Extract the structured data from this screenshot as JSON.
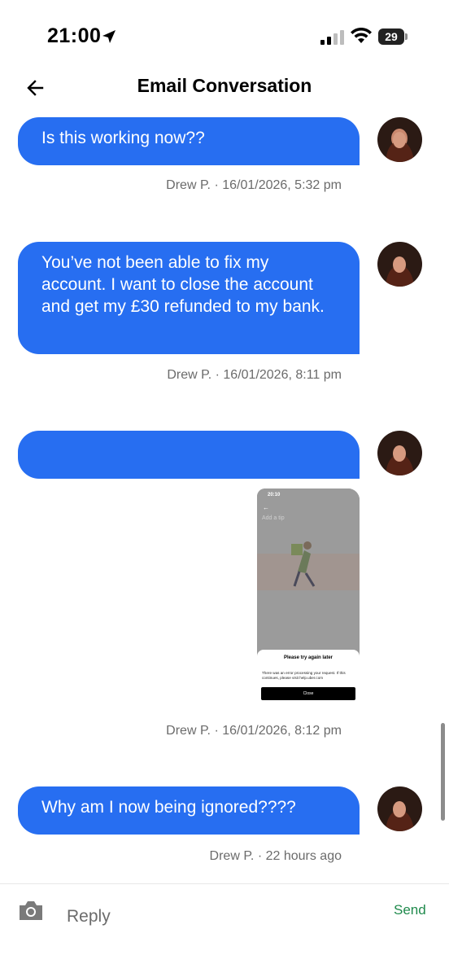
{
  "status_bar": {
    "time": "21:00",
    "battery": "29"
  },
  "header": {
    "title": "Email Conversation",
    "back_icon": "arrow-left-icon"
  },
  "messages": [
    {
      "text": "Is this working now??",
      "meta": "Drew P. · 16/01/2026, 5:32 pm"
    },
    {
      "text": "You’ve not been able to fix my account. I want to close the account and get my £30 refunded to my bank.",
      "meta": "Drew P. · 16/01/2026, 8:11 pm"
    },
    {
      "text": "",
      "meta": "Drew P. · 16/01/2026, 8:12 pm"
    },
    {
      "text": "Why am I now being ignored????",
      "meta": "Drew P. · 22 hours ago"
    }
  ],
  "attachment": {
    "status_time": "20:10",
    "screen_title": "Add a tip",
    "dialog_title": "Please try again later",
    "dialog_body": "There was an error processing your request. If this continues, please visit help.uber.com",
    "dialog_button": "Close"
  },
  "reply": {
    "placeholder": "Reply",
    "send_label": "Send",
    "camera_icon": "camera-icon"
  },
  "colors": {
    "bubble": "#276ef1",
    "send": "#1f8a4c"
  }
}
